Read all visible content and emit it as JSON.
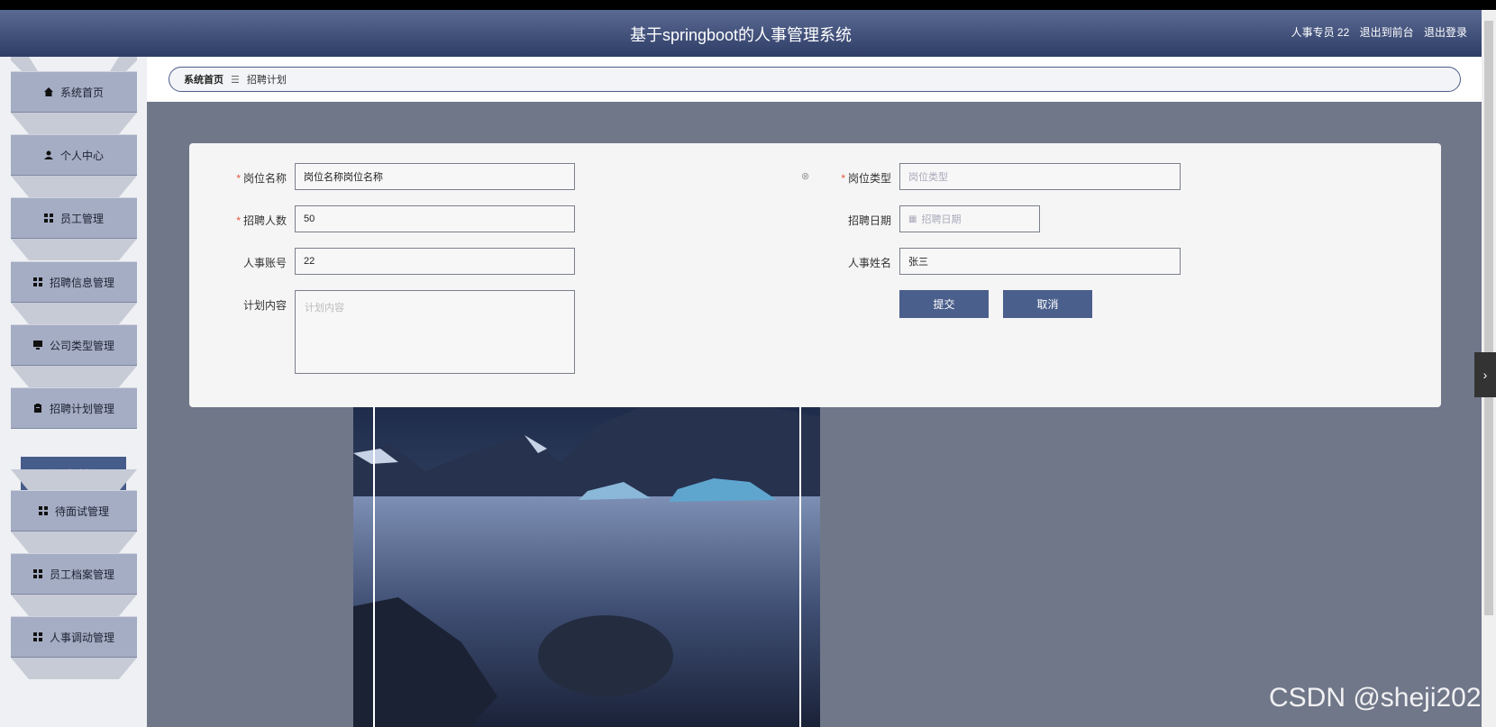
{
  "header": {
    "title": "基于springboot的人事管理系统",
    "user_label": "人事专员 22",
    "to_frontend": "退出到前台",
    "logout": "退出登录"
  },
  "sidebar": {
    "items": [
      {
        "label": "系统首页",
        "icon": "home-icon"
      },
      {
        "label": "个人中心",
        "icon": "user-icon"
      },
      {
        "label": "员工管理",
        "icon": "grid-icon"
      },
      {
        "label": "招聘信息管理",
        "icon": "grid-icon"
      },
      {
        "label": "公司类型管理",
        "icon": "monitor-icon"
      },
      {
        "label": "招聘计划管理",
        "icon": "clipboard-icon"
      },
      {
        "label": "待面试管理",
        "icon": "grid-icon"
      },
      {
        "label": "员工档案管理",
        "icon": "grid-icon"
      },
      {
        "label": "人事调动管理",
        "icon": "grid-icon"
      }
    ],
    "submenu_active": "招聘计划"
  },
  "breadcrumb": {
    "home": "系统首页",
    "separator": "☰",
    "current": "招聘计划"
  },
  "form": {
    "position_name": {
      "label": "岗位名称",
      "value": "岗位名称岗位名称",
      "required": true
    },
    "position_type": {
      "label": "岗位类型",
      "placeholder": "岗位类型",
      "required": true
    },
    "headcount": {
      "label": "招聘人数",
      "value": "50",
      "required": true
    },
    "recruit_date": {
      "label": "招聘日期",
      "placeholder": "招聘日期"
    },
    "hr_account": {
      "label": "人事账号",
      "value": "22"
    },
    "hr_name": {
      "label": "人事姓名",
      "value": "张三"
    },
    "plan_content": {
      "label": "计划内容",
      "placeholder": "计划内容"
    },
    "submit": "提交",
    "cancel": "取消"
  },
  "watermark": "CSDN @sheji202"
}
